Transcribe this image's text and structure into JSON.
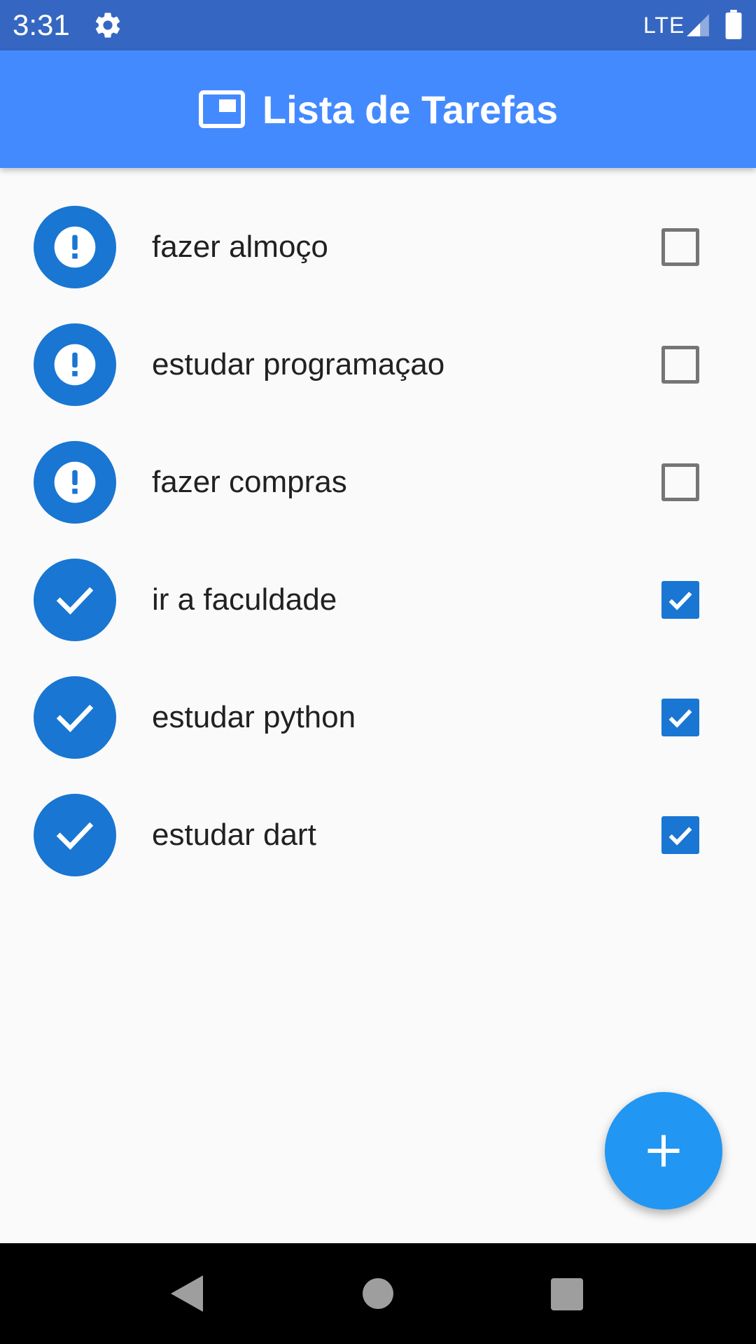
{
  "status_bar": {
    "time": "3:31",
    "network": "LTE",
    "settings_icon": "gear-icon",
    "signal_icon": "cellular-signal-icon",
    "battery_icon": "battery-icon",
    "background_color": "#3567c2"
  },
  "app_bar": {
    "title": "Lista de Tarefas",
    "icon": "picture-in-picture-icon",
    "background_color": "#448aff"
  },
  "tasks": [
    {
      "label": "fazer almoço",
      "done": false,
      "status_icon": "exclamation-icon"
    },
    {
      "label": "estudar programaçao",
      "done": false,
      "status_icon": "exclamation-icon"
    },
    {
      "label": "fazer compras",
      "done": false,
      "status_icon": "exclamation-icon"
    },
    {
      "label": "ir a faculdade",
      "done": true,
      "status_icon": "check-icon"
    },
    {
      "label": "estudar python",
      "done": true,
      "status_icon": "check-icon"
    },
    {
      "label": "estudar dart",
      "done": true,
      "status_icon": "check-icon"
    }
  ],
  "fab": {
    "icon": "plus-icon",
    "color": "#2196f3"
  },
  "nav_bar": {
    "back_icon": "back-triangle-icon",
    "home_icon": "home-circle-icon",
    "recents_icon": "recents-square-icon"
  },
  "colors": {
    "avatar": "#1976d2",
    "checkbox_checked": "#1976d2",
    "checkbox_unchecked_border": "#757575",
    "background": "#fafafa"
  }
}
